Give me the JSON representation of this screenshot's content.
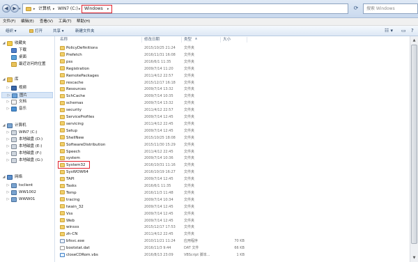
{
  "address_bar": {
    "crumbs": [
      "计算机",
      "WIN7 (C:)",
      "Windows"
    ],
    "search_placeholder": "搜索 Windows"
  },
  "menu": [
    "文件(F)",
    "编辑(E)",
    "查看(V)",
    "工具(T)",
    "帮助(H)"
  ],
  "toolbar": {
    "organize": "组织 ▾",
    "open": "打开",
    "share": "共享 ▾",
    "new_folder": "新建文件夹"
  },
  "nav": {
    "favorites": "收藏夹",
    "downloads": "下载",
    "desktop": "桌面",
    "recent": "最近访问的位置",
    "libraries": "库",
    "videos": "视频",
    "pictures": "图片",
    "documents": "文档",
    "music": "音乐",
    "computer": "计算机",
    "win7_c": "WIN7 (C:)",
    "disk_d": "本地磁盘 (D:)",
    "disk_e": "本地磁盘 (E:)",
    "disk_f": "本地磁盘 (F:)",
    "disk_g": "本地磁盘 (G:)",
    "network": "网络",
    "tsclient": "tsclient",
    "ww1002": "WW1002",
    "www01": "WWW01"
  },
  "columns": {
    "name": "名称",
    "date": "修改日期",
    "type": "类型",
    "size": "大小"
  },
  "files": [
    {
      "name": "PolicyDefinitions",
      "date": "2015/10/25 21:24",
      "type": "文件夹",
      "size": "",
      "kind": "folder"
    },
    {
      "name": "Prefetch",
      "date": "2016/11/31 16:08",
      "type": "文件夹",
      "size": "",
      "kind": "folder"
    },
    {
      "name": "pss",
      "date": "2016/6/1 11:35",
      "type": "文件夹",
      "size": "",
      "kind": "folder"
    },
    {
      "name": "Registration",
      "date": "2009/7/14 11:20",
      "type": "文件夹",
      "size": "",
      "kind": "folder"
    },
    {
      "name": "RemotePackages",
      "date": "2011/4/12 22:57",
      "type": "文件夹",
      "size": "",
      "kind": "folder"
    },
    {
      "name": "rescache",
      "date": "2015/12/17 16:18",
      "type": "文件夹",
      "size": "",
      "kind": "folder"
    },
    {
      "name": "Resources",
      "date": "2009/7/14 13:32",
      "type": "文件夹",
      "size": "",
      "kind": "folder"
    },
    {
      "name": "SchCache",
      "date": "2009/7/14 10:35",
      "type": "文件夹",
      "size": "",
      "kind": "folder"
    },
    {
      "name": "schemas",
      "date": "2009/7/14 13:32",
      "type": "文件夹",
      "size": "",
      "kind": "folder"
    },
    {
      "name": "security",
      "date": "2011/4/12 22:57",
      "type": "文件夹",
      "size": "",
      "kind": "folder"
    },
    {
      "name": "ServiceProfiles",
      "date": "2009/7/14 12:45",
      "type": "文件夹",
      "size": "",
      "kind": "folder"
    },
    {
      "name": "servicing",
      "date": "2011/4/12 22:45",
      "type": "文件夹",
      "size": "",
      "kind": "folder"
    },
    {
      "name": "Setup",
      "date": "2009/7/14 12:45",
      "type": "文件夹",
      "size": "",
      "kind": "folder"
    },
    {
      "name": "ShellNew",
      "date": "2015/10/25 18:08",
      "type": "文件夹",
      "size": "",
      "kind": "folder"
    },
    {
      "name": "SoftwareDistribution",
      "date": "2015/11/30 15:29",
      "type": "文件夹",
      "size": "",
      "kind": "folder"
    },
    {
      "name": "Speech",
      "date": "2011/4/12 22:45",
      "type": "文件夹",
      "size": "",
      "kind": "folder"
    },
    {
      "name": "system",
      "date": "2009/7/14 10:36",
      "type": "文件夹",
      "size": "",
      "kind": "folder"
    },
    {
      "name": "System32",
      "date": "2016/10/31 11:16",
      "type": "文件夹",
      "size": "",
      "kind": "folder"
    },
    {
      "name": "SysWOW64",
      "date": "2016/10/19 16:27",
      "type": "文件夹",
      "size": "",
      "kind": "folder"
    },
    {
      "name": "TAPI",
      "date": "2009/7/14 12:45",
      "type": "文件夹",
      "size": "",
      "kind": "folder"
    },
    {
      "name": "Tasks",
      "date": "2016/6/1 11:35",
      "type": "文件夹",
      "size": "",
      "kind": "folder"
    },
    {
      "name": "Temp",
      "date": "2016/11/3 11:48",
      "type": "文件夹",
      "size": "",
      "kind": "folder"
    },
    {
      "name": "tracing",
      "date": "2009/7/14 10:34",
      "type": "文件夹",
      "size": "",
      "kind": "folder"
    },
    {
      "name": "twain_32",
      "date": "2009/7/14 12:45",
      "type": "文件夹",
      "size": "",
      "kind": "folder"
    },
    {
      "name": "Vss",
      "date": "2009/7/14 12:45",
      "type": "文件夹",
      "size": "",
      "kind": "folder"
    },
    {
      "name": "Web",
      "date": "2009/7/14 12:45",
      "type": "文件夹",
      "size": "",
      "kind": "folder"
    },
    {
      "name": "winsxs",
      "date": "2015/12/17 17:53",
      "type": "文件夹",
      "size": "",
      "kind": "folder"
    },
    {
      "name": "zh-CN",
      "date": "2011/4/12 22:45",
      "type": "文件夹",
      "size": "",
      "kind": "folder"
    },
    {
      "name": "bfsvc.exe",
      "date": "2010/11/21 11:24",
      "type": "应用程序",
      "size": "70 KB",
      "kind": "exe"
    },
    {
      "name": "bootstat.dat",
      "date": "2016/11/3 9:44",
      "type": "DAT 文件",
      "size": "66 KB",
      "kind": "dat"
    },
    {
      "name": "closeCDRom.vbs",
      "date": "2016/8/13 23:09",
      "type": "VBScript 脚本...",
      "size": "1 KB",
      "kind": "vbs"
    }
  ]
}
